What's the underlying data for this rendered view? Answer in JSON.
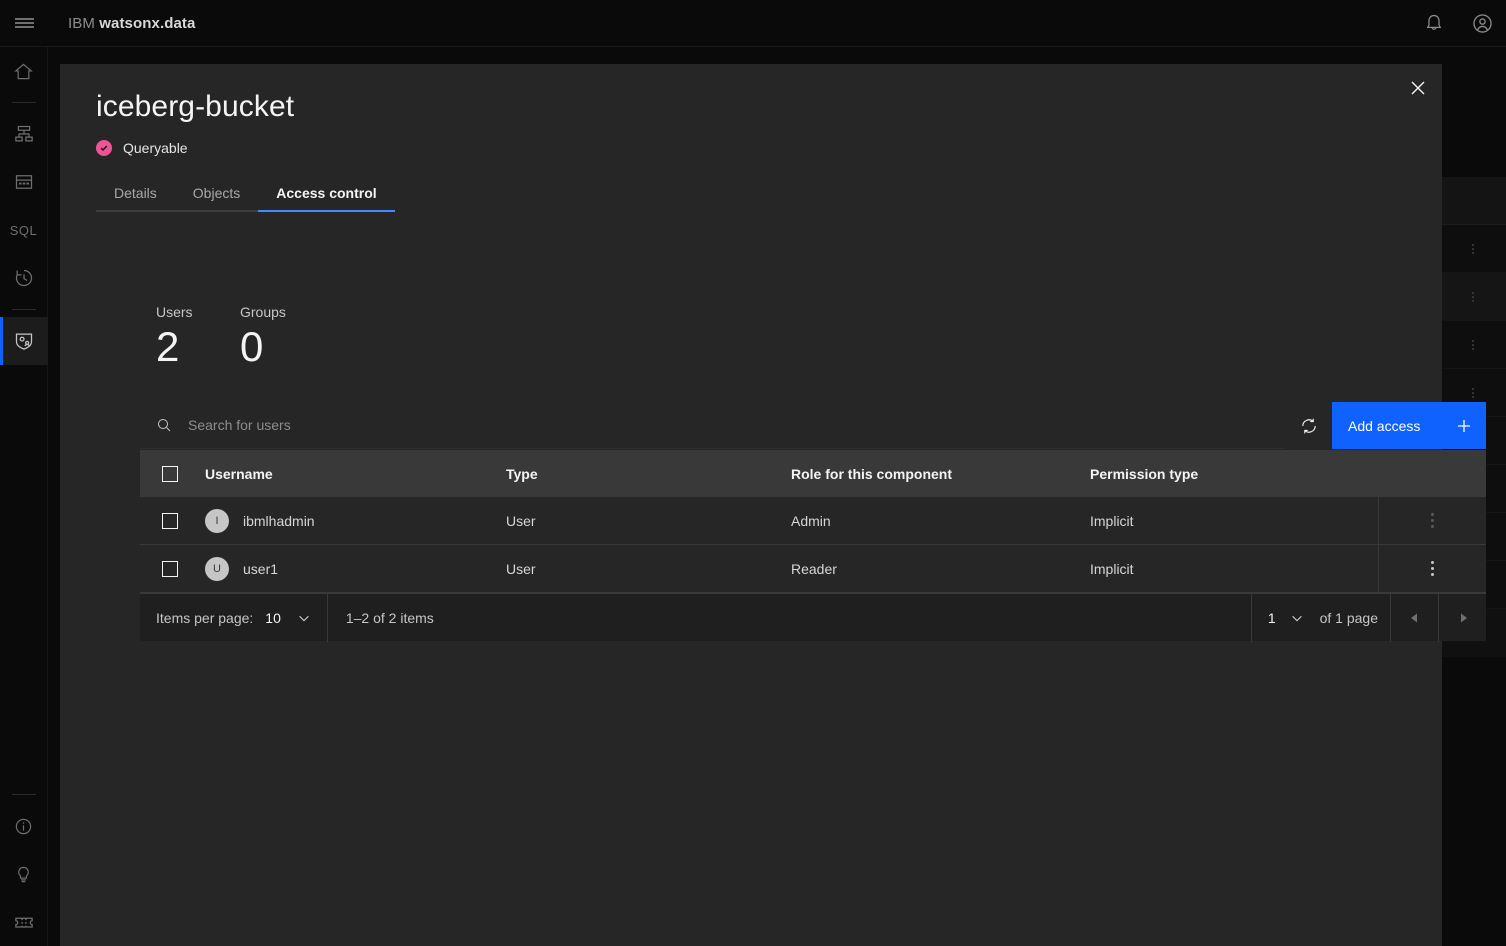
{
  "topbar": {
    "menu_icon": "hamburger-icon",
    "brand_prefix": "IBM",
    "brand_name": "watsonx.data",
    "notifications_icon": "bell-icon",
    "account_icon": "user-avatar-icon"
  },
  "sidebar": {
    "items": [
      {
        "name": "home",
        "icon": "home-icon",
        "active": false
      },
      {
        "name": "infrastructure",
        "icon": "hierarchy-icon",
        "active": false
      },
      {
        "name": "data-manager",
        "icon": "table-icon",
        "active": false
      },
      {
        "name": "query-workspace",
        "icon": "sql-icon",
        "active": false
      },
      {
        "name": "query-history",
        "icon": "history-clock-icon",
        "active": false
      },
      {
        "name": "access-control",
        "icon": "shield-user-icon",
        "active": true
      },
      {
        "name": "about",
        "icon": "information-icon",
        "active": false
      },
      {
        "name": "tips",
        "icon": "lightbulb-icon",
        "active": false
      },
      {
        "name": "support",
        "icon": "ticket-icon",
        "active": false
      }
    ]
  },
  "panel": {
    "title": "iceberg-bucket",
    "close_icon": "close-icon",
    "status": {
      "label": "Queryable",
      "icon": "checkmark-filled-icon",
      "color": "#ee5396"
    },
    "tabs": [
      {
        "label": "Details",
        "active": false
      },
      {
        "label": "Objects",
        "active": false
      },
      {
        "label": "Access control",
        "active": true
      }
    ],
    "summary": [
      {
        "label": "Users",
        "value": "2"
      },
      {
        "label": "Groups",
        "value": "0"
      }
    ],
    "toolbar": {
      "search_placeholder": "Search for users",
      "search_value": "",
      "search_icon": "search-icon",
      "refresh_icon": "refresh-icon",
      "add_label": "Add access",
      "add_icon": "add-icon",
      "accent_color": "#0f62fe"
    },
    "table": {
      "columns": [
        "Username",
        "Type",
        "Role for this component",
        "Permission type"
      ],
      "rows": [
        {
          "avatar": "I",
          "username": "ibmlhadmin",
          "type": "User",
          "role": "Admin",
          "permission": "Implicit",
          "menu_icon": "overflow-menu-icon",
          "menu_dim": true
        },
        {
          "avatar": "U",
          "username": "user1",
          "type": "User",
          "role": "Reader",
          "permission": "Implicit",
          "menu_icon": "overflow-menu-icon",
          "menu_dim": false
        }
      ]
    },
    "pagination": {
      "items_per_page_label": "Items per page:",
      "items_per_page_value": "10",
      "range_text": "1–2 of 2 items",
      "page_value": "1",
      "of_pages_text": "of 1 page",
      "prev_icon": "caret-left-icon",
      "next_icon": "caret-right-icon"
    }
  },
  "background": {
    "rows": 8,
    "overflow_icon": "overflow-menu-icon",
    "play_icon": "caret-right-icon"
  }
}
